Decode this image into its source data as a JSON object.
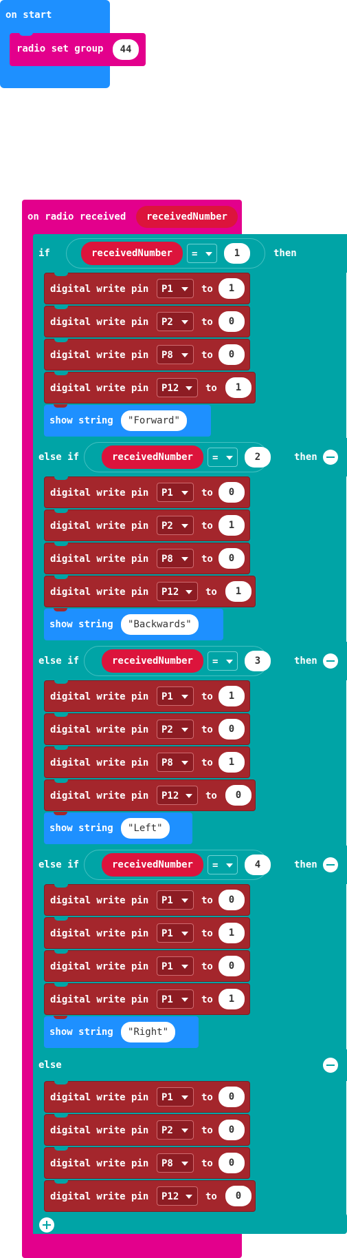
{
  "on_start": {
    "label": "on start",
    "radio_set_group": {
      "label": "radio set group",
      "value": "44"
    }
  },
  "on_radio_received": {
    "label": "on radio received",
    "variable": "receivedNumber",
    "branches": [
      {
        "keyword": "if",
        "variable": "receivedNumber",
        "operator": "=",
        "value": "1",
        "then": "then",
        "writes": [
          {
            "label": "digital write pin",
            "pin": "P1",
            "to": "to",
            "value": "1"
          },
          {
            "label": "digital write pin",
            "pin": "P2",
            "to": "to",
            "value": "0"
          },
          {
            "label": "digital write pin",
            "pin": "P8",
            "to": "to",
            "value": "0"
          },
          {
            "label": "digital write pin",
            "pin": "P12",
            "to": "to",
            "value": "1"
          }
        ],
        "show": {
          "label": "show string",
          "text": "Forward"
        }
      },
      {
        "keyword": "else if",
        "variable": "receivedNumber",
        "operator": "=",
        "value": "2",
        "then": "then",
        "writes": [
          {
            "label": "digital write pin",
            "pin": "P1",
            "to": "to",
            "value": "0"
          },
          {
            "label": "digital write pin",
            "pin": "P2",
            "to": "to",
            "value": "1"
          },
          {
            "label": "digital write pin",
            "pin": "P8",
            "to": "to",
            "value": "0"
          },
          {
            "label": "digital write pin",
            "pin": "P12",
            "to": "to",
            "value": "1"
          }
        ],
        "show": {
          "label": "show string",
          "text": "Backwards"
        }
      },
      {
        "keyword": "else if",
        "variable": "receivedNumber",
        "operator": "=",
        "value": "3",
        "then": "then",
        "writes": [
          {
            "label": "digital write pin",
            "pin": "P1",
            "to": "to",
            "value": "1"
          },
          {
            "label": "digital write pin",
            "pin": "P2",
            "to": "to",
            "value": "0"
          },
          {
            "label": "digital write pin",
            "pin": "P8",
            "to": "to",
            "value": "1"
          },
          {
            "label": "digital write pin",
            "pin": "P12",
            "to": "to",
            "value": "0"
          }
        ],
        "show": {
          "label": "show string",
          "text": "Left"
        }
      },
      {
        "keyword": "else if",
        "variable": "receivedNumber",
        "operator": "=",
        "value": "4",
        "then": "then",
        "writes": [
          {
            "label": "digital write pin",
            "pin": "P1",
            "to": "to",
            "value": "0"
          },
          {
            "label": "digital write pin",
            "pin": "P1",
            "to": "to",
            "value": "1"
          },
          {
            "label": "digital write pin",
            "pin": "P1",
            "to": "to",
            "value": "0"
          },
          {
            "label": "digital write pin",
            "pin": "P1",
            "to": "to",
            "value": "1"
          }
        ],
        "show": {
          "label": "show string",
          "text": "Right"
        }
      }
    ],
    "else": {
      "keyword": "else",
      "writes": [
        {
          "label": "digital write pin",
          "pin": "P1",
          "to": "to",
          "value": "0"
        },
        {
          "label": "digital write pin",
          "pin": "P2",
          "to": "to",
          "value": "0"
        },
        {
          "label": "digital write pin",
          "pin": "P8",
          "to": "to",
          "value": "0"
        },
        {
          "label": "digital write pin",
          "pin": "P12",
          "to": "to",
          "value": "0"
        }
      ]
    }
  },
  "colors": {
    "basic": "#1e90ff",
    "radio": "#e3008c",
    "logic": "#00a4a6",
    "pins": "#a4262c",
    "variable": "#dc143c"
  },
  "icons": [
    "minus-circle-icon",
    "plus-circle-icon",
    "dropdown-caret-icon"
  ]
}
